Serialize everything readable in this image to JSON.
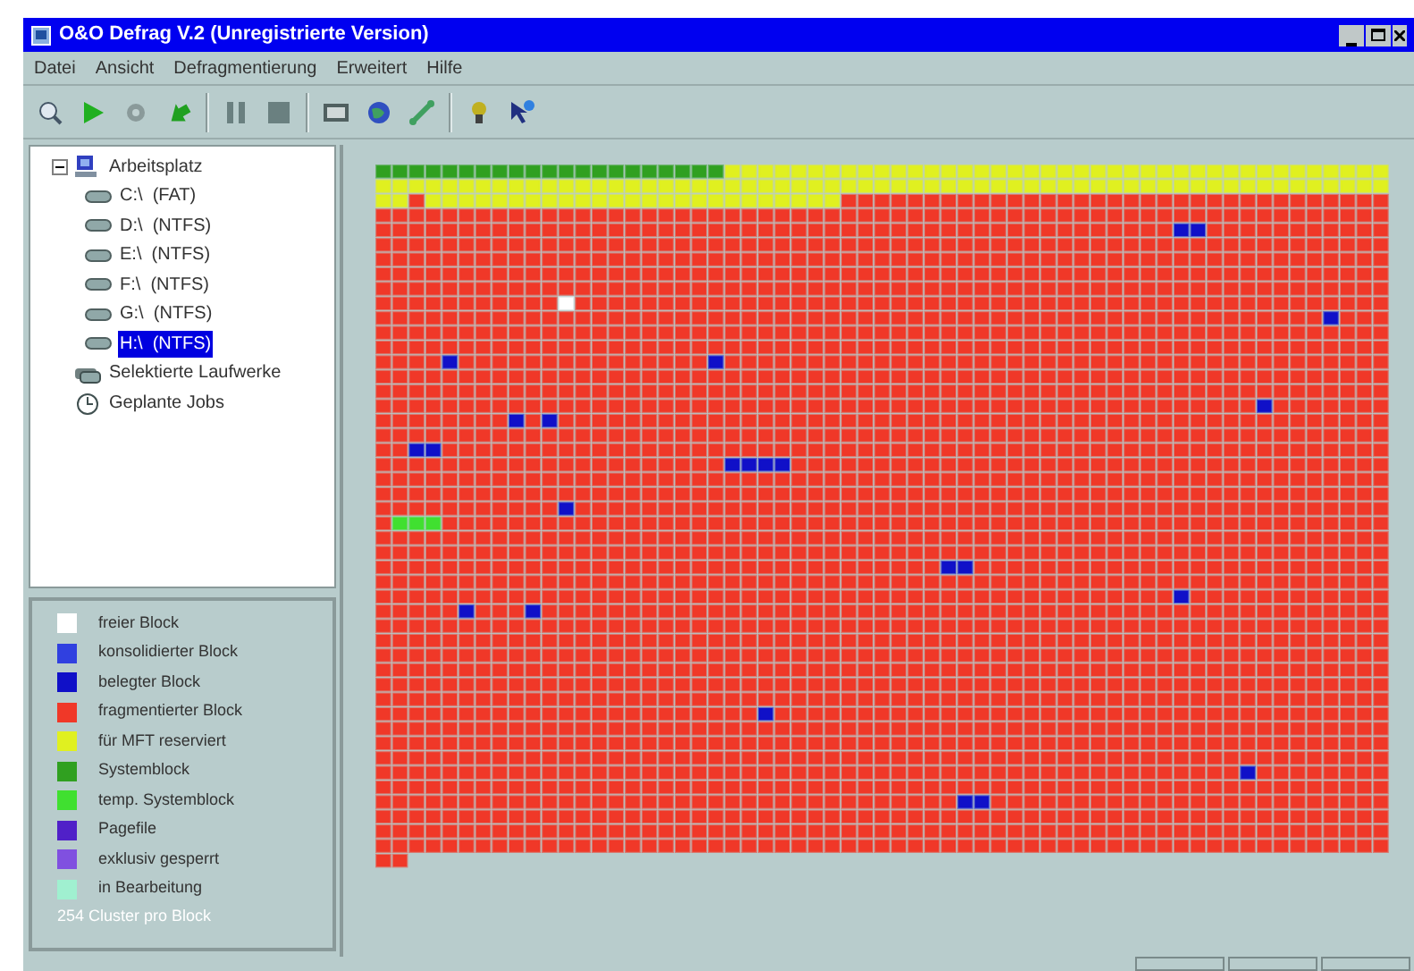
{
  "window": {
    "title": "O&O Defrag V.2 (Unregistrierte Version)"
  },
  "menu": [
    {
      "label": "Datei"
    },
    {
      "label": "Ansicht"
    },
    {
      "label": "Defragmentierung"
    },
    {
      "label": "Erweitert"
    },
    {
      "label": "Hilfe"
    }
  ],
  "toolbar": [
    {
      "kind": "zoom"
    },
    {
      "kind": "play"
    },
    {
      "kind": "gear"
    },
    {
      "kind": "arrow"
    },
    {
      "kind": "pause"
    },
    {
      "kind": "stop"
    },
    {
      "kind": "monitor"
    },
    {
      "kind": "globe"
    },
    {
      "kind": "wrench"
    },
    {
      "kind": "hint"
    },
    {
      "kind": "help"
    }
  ],
  "tree": [
    {
      "label": "Arbeitsplatz",
      "kind": "computer",
      "expanded": true,
      "selected": false,
      "children": [
        {
          "label": "C:\\  (FAT)",
          "kind": "drive",
          "selected": false
        },
        {
          "label": "D:\\  (NTFS)",
          "kind": "drive",
          "selected": false
        },
        {
          "label": "E:\\  (NTFS)",
          "kind": "drive",
          "selected": false
        },
        {
          "label": "F:\\  (NTFS)",
          "kind": "drive",
          "selected": false
        },
        {
          "label": "G:\\  (NTFS)",
          "kind": "drive",
          "selected": false
        },
        {
          "label": "H:\\  (NTFS)",
          "kind": "drive",
          "selected": true
        }
      ]
    },
    {
      "label": "Selektierte Laufwerke",
      "kind": "drives",
      "selected": false
    },
    {
      "label": "Geplante Jobs",
      "kind": "clock",
      "selected": false
    }
  ],
  "legend": {
    "items": [
      {
        "label": "freier Block",
        "color": "#ffffff"
      },
      {
        "label": "konsolidierter Block",
        "color": "#3040e0"
      },
      {
        "label": "belegter Block",
        "color": "#1010c8"
      },
      {
        "label": "fragmentierter Block",
        "color": "#f03828"
      },
      {
        "label": "für MFT reserviert",
        "color": "#e0f020"
      },
      {
        "label": "Systemblock",
        "color": "#30a020"
      },
      {
        "label": "temp. Systemblock",
        "color": "#40e030"
      },
      {
        "label": "Pagefile",
        "color": "#5020c8"
      },
      {
        "label": "exklusiv gesperrt",
        "color": "#8050e0"
      },
      {
        "label": "in Bearbeitung",
        "color": "#a0f0d0"
      }
    ],
    "note": "254 Cluster pro Block"
  }
}
